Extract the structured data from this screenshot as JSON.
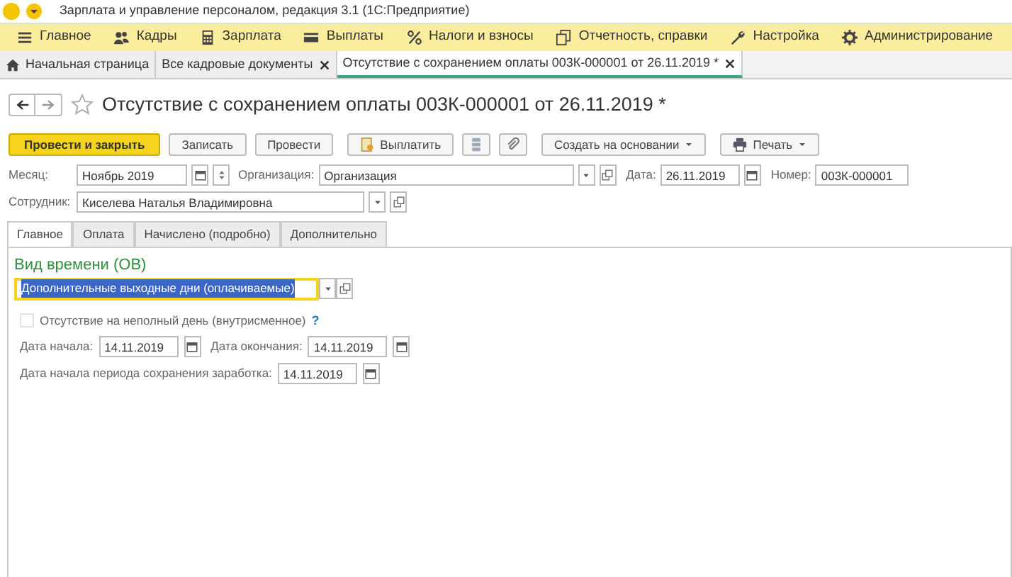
{
  "window": {
    "title": "Зарплата и управление персоналом, редакция 3.1  (1С:Предприятие)"
  },
  "sections": [
    {
      "label": "Главное",
      "kind": "menu"
    },
    {
      "label": "Кадры",
      "kind": "people"
    },
    {
      "label": "Зарплата",
      "kind": "calculator"
    },
    {
      "label": "Выплаты",
      "kind": "card"
    },
    {
      "label": "Налоги и взносы",
      "kind": "percent"
    },
    {
      "label": "Отчетность, справки",
      "kind": "pages"
    },
    {
      "label": "Настройка",
      "kind": "wrench"
    },
    {
      "label": "Администрирование",
      "kind": "gear"
    }
  ],
  "open_tabs": [
    {
      "label": "Начальная страница",
      "kind": "home",
      "selected": false
    },
    {
      "label": "Все кадровые документы",
      "kind": "closable",
      "selected": false
    },
    {
      "label": "Отсутствие с сохранением оплаты 003К-000001 от 26.11.2019 *",
      "kind": "closable",
      "selected": true
    }
  ],
  "document": {
    "title": "Отсутствие с сохранением оплаты 003К-000001 от 26.11.2019 *",
    "starred": false
  },
  "toolbar": [
    {
      "label": "Провести и закрыть",
      "kind": "primary"
    },
    {
      "label": "Записать",
      "kind": "plain"
    },
    {
      "label": "Провести",
      "kind": "plain"
    },
    {
      "label": "Выплатить",
      "kind": "pay"
    },
    {
      "kind": "archive"
    },
    {
      "kind": "clip"
    },
    {
      "label": "Создать на основании",
      "kind": "dropdown"
    },
    {
      "label": "Печать",
      "kind": "print"
    }
  ],
  "header": {
    "month_label": "Месяц:",
    "month": "Ноябрь 2019",
    "org_label": "Организация:",
    "org": "Организация",
    "date_label": "Дата:",
    "date": "26.11.2019",
    "number_label": "Номер:",
    "number": "003К-000001",
    "employee_label": "Сотрудник:",
    "employee": "Киселева Наталья Владимировна"
  },
  "inner_tabs": [
    {
      "label": "Главное",
      "selected": true
    },
    {
      "label": "Оплата",
      "selected": false
    },
    {
      "label": "Начислено (подробно)",
      "selected": false
    },
    {
      "label": "Дополнительно",
      "selected": false
    }
  ],
  "main": {
    "time_type_label": "Вид времени (ОВ)",
    "time_type": "Дополнительные выходные дни (оплачиваемые)",
    "time_type_focused": true,
    "partial_day": {
      "label": "Отсутствие на неполный день (внутрисменное)",
      "checked": false,
      "help": "?"
    },
    "start_label": "Дата начала:",
    "start": "14.11.2019",
    "end_label": "Дата окончания:",
    "end": "14.11.2019",
    "keep_label": "Дата начала периода сохранения заработка:",
    "keep": "14.11.2019"
  }
}
